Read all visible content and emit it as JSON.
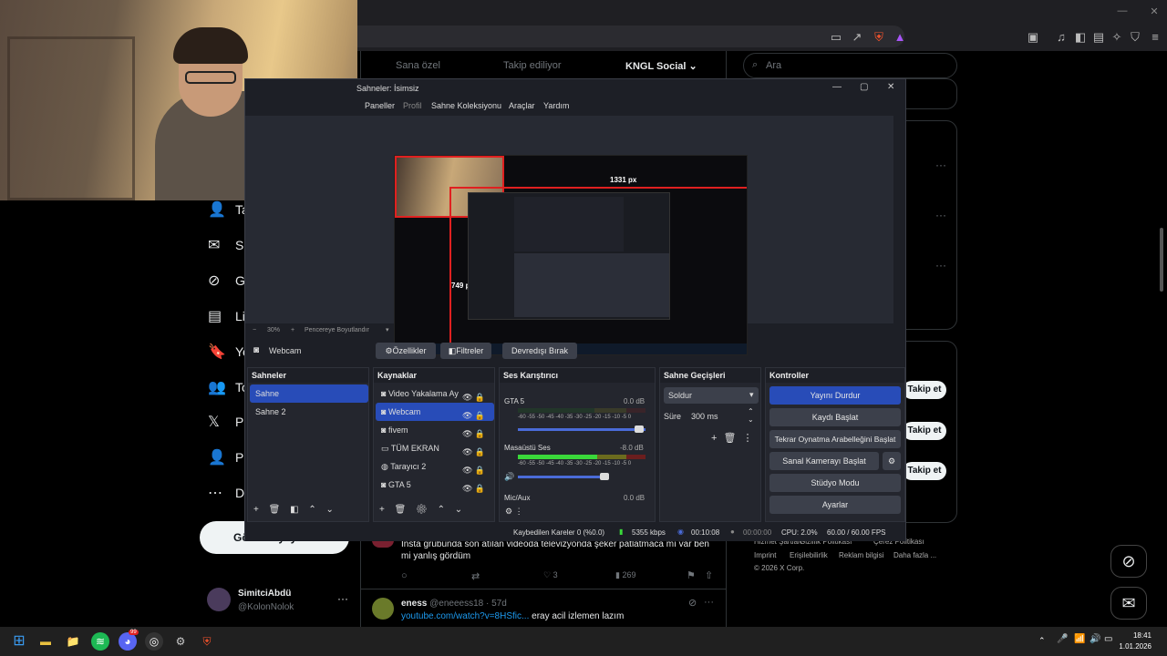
{
  "browser": {
    "window_controls": [
      "—",
      "▢",
      "✕"
    ],
    "icons": [
      "cast-icon",
      "share-icon",
      "brave-shield-icon",
      "brave-rewards-icon",
      "reader-icon",
      "music-icon",
      "sidebar-icon",
      "wallet-icon",
      "leo-icon",
      "vpn-icon",
      "menu-icon"
    ]
  },
  "x": {
    "tabs": [
      "Sana özel",
      "Takip ediliyor",
      "KNGL Social"
    ],
    "search_placeholder": "Ara",
    "nav": [
      {
        "icon": "add-user-icon",
        "label": "Ta"
      },
      {
        "icon": "mail-icon",
        "label": "So"
      },
      {
        "icon": "grok-icon",
        "label": "Gr"
      },
      {
        "icon": "list-icon",
        "label": "Lis"
      },
      {
        "icon": "bookmark-icon",
        "label": "Ye"
      },
      {
        "icon": "communities-icon",
        "label": "To"
      },
      {
        "icon": "x-logo-icon",
        "label": "Pr"
      },
      {
        "icon": "profile-icon",
        "label": "Pr"
      },
      {
        "icon": "more-icon",
        "label": "Da"
      }
    ],
    "post_button": "Gönderi yayınla",
    "account": {
      "name": "SimitciAbdü",
      "handle": "@KolonNolok"
    },
    "follow_label": "Takip et",
    "tweets": [
      {
        "text": "İnsta grubunda son atılan videoda televizyonda şeker patlatmaca mı var ben mi yanlış gördüm",
        "likes": "3",
        "views": "269"
      },
      {
        "name": "eness",
        "handle": "@eneeess18 · 57d",
        "link": "youtube.com/watch?v=8HSfic...",
        "text": " eray acil izlemen lazım"
      }
    ],
    "footer": [
      "Hizmet Şartları",
      "Gizlilik Politikası",
      "Çerez Politikası",
      "Imprint",
      "Erişilebilirlik",
      "Reklam bilgisi",
      "Daha fazla ...",
      "© 2026 X Corp."
    ]
  },
  "obs": {
    "title": "Sahneler: İsimsiz",
    "window_controls": [
      "—",
      "▢",
      "✕"
    ],
    "menu": [
      "Paneller",
      "Profil",
      "Sahne Koleksiyonu",
      "Araçlar",
      "Yardım"
    ],
    "preview_labels": {
      "width": "1331 px",
      "height": "749 px"
    },
    "zoom": {
      "minus": "−",
      "percent": "30%",
      "plus": "+",
      "fit": "Pencereye Boyutlandır"
    },
    "selected_source": "Webcam",
    "source_buttons": {
      "properties": "Özellikler",
      "filters": "Filtreler",
      "deactivate": "Devredışı Bırak"
    },
    "docks": {
      "scenes": {
        "title": "Sahneler",
        "items": [
          "Sahne",
          "Sahne 2"
        ]
      },
      "sources": {
        "title": "Kaynaklar",
        "items": [
          {
            "icon": "camera-icon",
            "label": "Video Yakalama Ay"
          },
          {
            "icon": "camera-icon",
            "label": "Webcam"
          },
          {
            "icon": "camera-icon",
            "label": "fivem"
          },
          {
            "icon": "monitor-icon",
            "label": "TÜM EKRAN"
          },
          {
            "icon": "globe-icon",
            "label": "Tarayıcı 2"
          },
          {
            "icon": "camera-icon",
            "label": "GTA 5"
          }
        ]
      },
      "mixer": {
        "title": "Ses Karıştırıcı",
        "channels": [
          {
            "name": "GTA 5",
            "db": "0.0 dB",
            "level": 0.0,
            "volume": 0.98
          },
          {
            "name": "Masaüstü Ses",
            "db": "-8.0 dB",
            "level": 0.62,
            "volume": 0.68
          },
          {
            "name": "Mic/Aux",
            "db": "0.0 dB",
            "level": 0.0,
            "volume": 1.0
          }
        ],
        "ticks": "-60 -55 -50 -45 -40 -35 -30 -25 -20 -15 -10 -5 0"
      },
      "transitions": {
        "title": "Sahne Geçişleri",
        "type": "Soldur",
        "duration_label": "Süre",
        "duration": "300 ms"
      },
      "controls": {
        "title": "Kontroller",
        "buttons": [
          "Yayını Durdur",
          "Kaydı Başlat",
          "Tekrar Oynatma Arabelleğini Başlat",
          "Sanal Kamerayı Başlat",
          "Stüdyo Modu",
          "Ayarlar"
        ]
      }
    },
    "status": {
      "dropped": "Kaybedilen Kareler 0 (%0.0)",
      "bitrate": "5355 kbps",
      "live_time": "00:10:08",
      "rec_time": "00:00:00",
      "cpu": "CPU: 2.0%",
      "fps": "60.00 / 60.00 FPS"
    }
  },
  "taskbar": {
    "apps": [
      "windows-icon",
      "file-explorer-icon",
      "spotify-icon",
      "discord-icon",
      "obs-icon",
      "steam-icon",
      "brave-icon"
    ],
    "discord_badge": "99",
    "time": "18:41",
    "date": "1.01.2026"
  }
}
